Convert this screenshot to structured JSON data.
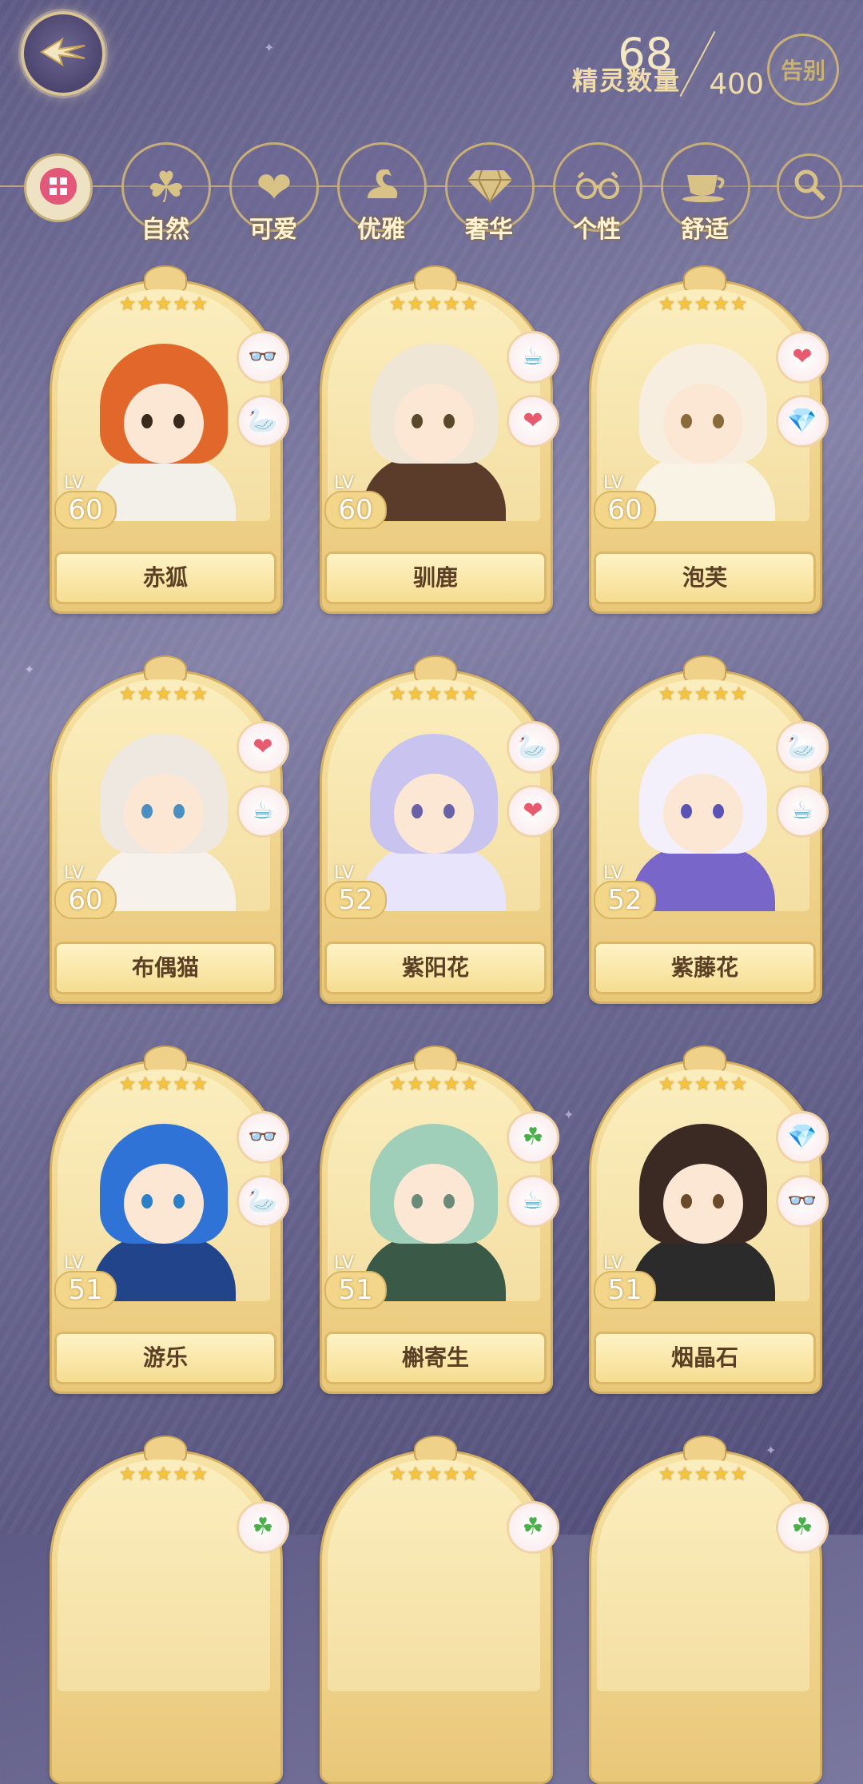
{
  "header": {
    "count_label": "精灵数量",
    "count_current": "68",
    "count_max": "400",
    "farewell_label": "告别"
  },
  "filters": [
    {
      "label": "",
      "icon": "all-grid-icon"
    },
    {
      "label": "自然",
      "icon": "clover-icon"
    },
    {
      "label": "可爱",
      "icon": "heart-icon"
    },
    {
      "label": "优雅",
      "icon": "swan-icon"
    },
    {
      "label": "奢华",
      "icon": "diamond-icon"
    },
    {
      "label": "个性",
      "icon": "glasses-icon"
    },
    {
      "label": "舒适",
      "icon": "teacup-icon"
    },
    {
      "label": "",
      "icon": "search-icon"
    }
  ],
  "spirits": [
    {
      "name": "赤狐",
      "level_label": "LV",
      "level": "60",
      "stars": "★★★★★",
      "badges": [
        "glasses-icon",
        "swan-icon"
      ],
      "hair_color": "#e2672a",
      "outfit_color": "#f3f0ea",
      "eye_color": "#3a2a1e"
    },
    {
      "name": "驯鹿",
      "level_label": "LV",
      "level": "60",
      "stars": "★★★★★",
      "badges": [
        "teacup-icon",
        "heart-icon"
      ],
      "hair_color": "#efe6d6",
      "outfit_color": "#5b3c2b",
      "eye_color": "#5a4a2a"
    },
    {
      "name": "泡芙",
      "level_label": "LV",
      "level": "60",
      "stars": "★★★★★",
      "badges": [
        "heart-icon",
        "diamond-icon"
      ],
      "hair_color": "#f7eedf",
      "outfit_color": "#f9f3e6",
      "eye_color": "#8a6a3a"
    },
    {
      "name": "布偶猫",
      "level_label": "LV",
      "level": "60",
      "stars": "★★★★★",
      "badges": [
        "heart-icon",
        "teacup-icon"
      ],
      "hair_color": "#efe8e0",
      "outfit_color": "#f6f1ea",
      "eye_color": "#4a8fc2"
    },
    {
      "name": "紫阳花",
      "level_label": "LV",
      "level": "52",
      "stars": "★★★★★",
      "badges": [
        "swan-icon",
        "heart-icon"
      ],
      "hair_color": "#c9c4ef",
      "outfit_color": "#e7e4fb",
      "eye_color": "#6a62a8"
    },
    {
      "name": "紫藤花",
      "level_label": "LV",
      "level": "52",
      "stars": "★★★★★",
      "badges": [
        "swan-icon",
        "teacup-icon"
      ],
      "hair_color": "#f3f0fb",
      "outfit_color": "#7867c8",
      "eye_color": "#5a52b5"
    },
    {
      "name": "游乐",
      "level_label": "LV",
      "level": "51",
      "stars": "★★★★★",
      "badges": [
        "glasses-icon",
        "swan-icon"
      ],
      "hair_color": "#2f73d6",
      "outfit_color": "#22448a",
      "eye_color": "#2a7fc9"
    },
    {
      "name": "槲寄生",
      "level_label": "LV",
      "level": "51",
      "stars": "★★★★★",
      "badges": [
        "clover-icon",
        "teacup-icon"
      ],
      "hair_color": "#9fcfb8",
      "outfit_color": "#3a5a47",
      "eye_color": "#6a8a7a"
    },
    {
      "name": "烟晶石",
      "level_label": "LV",
      "level": "51",
      "stars": "★★★★★",
      "badges": [
        "diamond-icon",
        "glasses-icon"
      ],
      "hair_color": "#3b2a24",
      "outfit_color": "#2b2b2b",
      "eye_color": "#6a4a2a"
    }
  ],
  "partial_row": {
    "stars": "★★★★★",
    "badges": [
      "clover-icon",
      "clover-icon",
      "clover-icon"
    ]
  },
  "icon_glyphs": {
    "heart-icon": "❤",
    "swan-icon": "🦢",
    "glasses-icon": "👓",
    "teacup-icon": "☕",
    "diamond-icon": "💎",
    "clover-icon": "☘"
  },
  "colors": {
    "gold": "#d4b062",
    "card_bg": "#f7e3a6",
    "badge_heart": "#e85b6e",
    "badge_swan": "#b78cd6",
    "badge_glasses": "#e9903a",
    "badge_teacup": "#58b3c9",
    "badge_diamond": "#b9c838",
    "badge_clover": "#4bb04b"
  }
}
